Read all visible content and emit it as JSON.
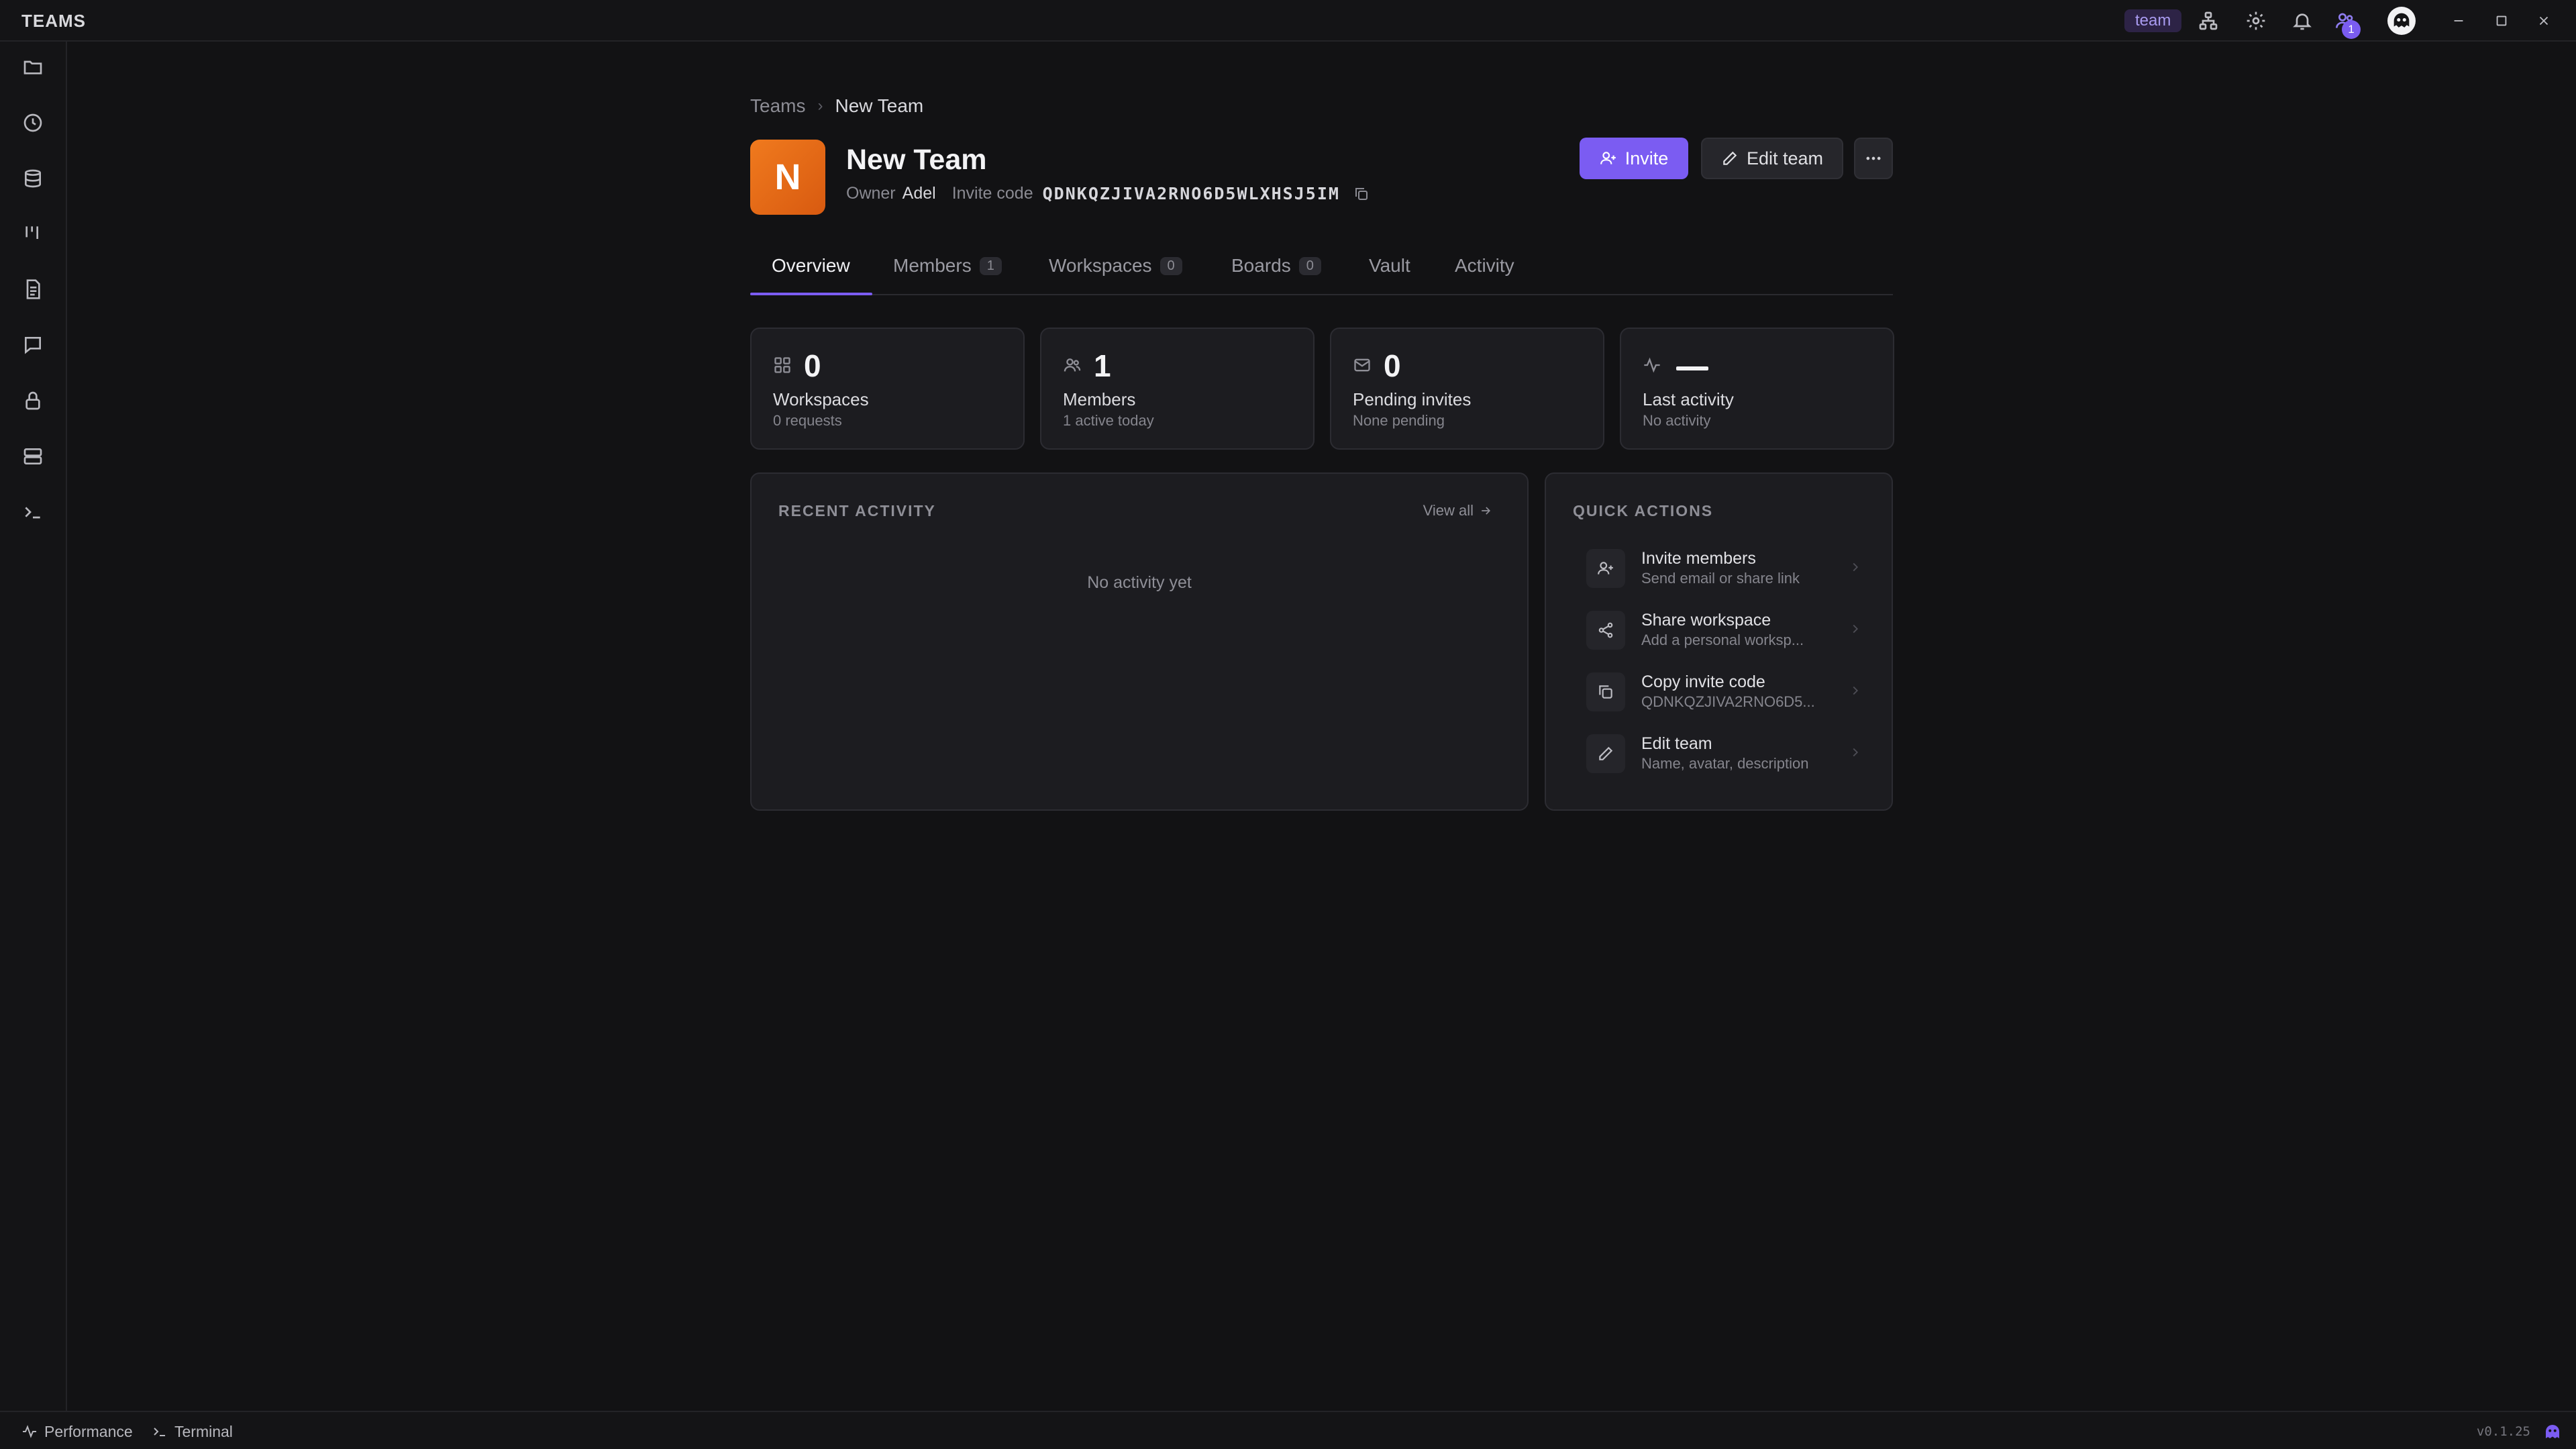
{
  "app": {
    "title": "TEAMS",
    "mode_badge": "team",
    "notification_count": "1",
    "version": "v0.1.25"
  },
  "sidebar": {
    "items": [
      {
        "icon": "folder-icon"
      },
      {
        "icon": "history-icon"
      },
      {
        "icon": "database-icon"
      },
      {
        "icon": "kanban-icon"
      },
      {
        "icon": "document-icon"
      },
      {
        "icon": "chat-icon"
      },
      {
        "icon": "lock-icon"
      },
      {
        "icon": "server-icon"
      },
      {
        "icon": "terminal-icon"
      }
    ]
  },
  "statusbar": {
    "performance": "Performance",
    "terminal": "Terminal"
  },
  "breadcrumb": {
    "root": "Teams",
    "separator": "›",
    "current": "New Team"
  },
  "team": {
    "initial": "N",
    "name": "New Team",
    "owner_label": "Owner",
    "owner": "Adel",
    "invite_code_label": "Invite code",
    "invite_code": "QDNKQZJIVA2RNO6D5WLXHSJ5IM",
    "avatar_color": "#ee7418"
  },
  "actions": {
    "invite": "Invite",
    "edit_team": "Edit team"
  },
  "tabs": [
    {
      "label": "Overview"
    },
    {
      "label": "Members",
      "count": "1"
    },
    {
      "label": "Workspaces",
      "count": "0"
    },
    {
      "label": "Boards",
      "count": "0"
    },
    {
      "label": "Vault"
    },
    {
      "label": "Activity"
    }
  ],
  "stats": [
    {
      "icon": "grid-icon",
      "value": "0",
      "label": "Workspaces",
      "sub": "0 requests"
    },
    {
      "icon": "users-icon",
      "value": "1",
      "label": "Members",
      "sub": "1 active today"
    },
    {
      "icon": "mail-icon",
      "value": "0",
      "label": "Pending invites",
      "sub": "None pending"
    },
    {
      "icon": "activity-icon",
      "value": "",
      "label": "Last activity",
      "sub": "No activity"
    }
  ],
  "recent_activity": {
    "heading": "RECENT ACTIVITY",
    "view_all": "View all",
    "empty": "No activity yet"
  },
  "quick_actions": {
    "heading": "QUICK ACTIONS",
    "items": [
      {
        "icon": "user-plus-icon",
        "title": "Invite members",
        "sub": "Send email or share link"
      },
      {
        "icon": "share-icon",
        "title": "Share workspace",
        "sub": "Add a personal worksp..."
      },
      {
        "icon": "copy-icon",
        "title": "Copy invite code",
        "sub": "QDNKQZJIVA2RNO6D5..."
      },
      {
        "icon": "edit-icon",
        "title": "Edit team",
        "sub": "Name, avatar, description"
      }
    ]
  },
  "colors": {
    "accent": "#7b5cf2",
    "background": "#121214",
    "card": "#1c1c20"
  }
}
